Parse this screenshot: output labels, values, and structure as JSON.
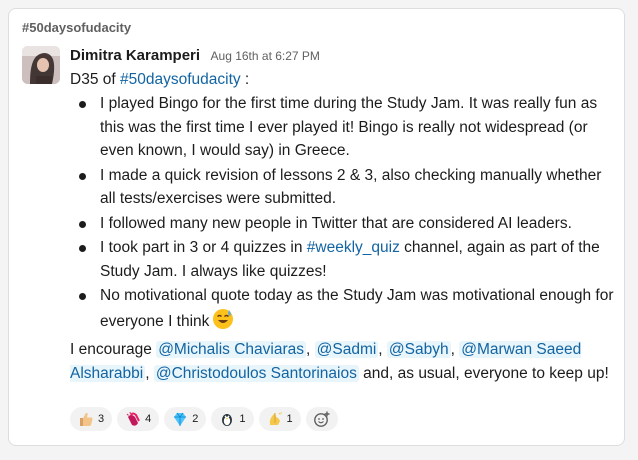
{
  "channel": "#50daysofudacity",
  "message": {
    "author": "Dimitra Karamperi",
    "timestamp": "Aug 16th at 6:27 PM",
    "intro_prefix": "D35 of ",
    "intro_hashtag": "#50daysofudacity",
    "intro_suffix": " :",
    "bullets": [
      "I played Bingo for the first time during the Study Jam. It was really fun as this was the first time I ever played it! Bingo is really not widespread (or even known, I would say) in Greece.",
      "I made a quick revision of lessons 2 & 3, also checking manually whether all tests/exercises were submitted.",
      "I followed many new people in Twitter that are considered AI leaders."
    ],
    "bullet4_before": "I took part in 3 or 4 quizzes in ",
    "bullet4_channel": "#weekly_quiz",
    "bullet4_after": " channel, again as part of the Study Jam. I always like quizzes!",
    "bullet5": "No motivational quote today as the Study Jam was motivational enough for everyone I think",
    "closing_before": "I encourage ",
    "mentions": [
      "@Michalis Chaviaras",
      "@Sadmi",
      "@Sabyh",
      "@Marwan Saeed Alsharabbi",
      "@Christodoulos Santorinaios"
    ],
    "separator": ", ",
    "closing_after": " and, as usual, everyone to keep up!"
  },
  "reactions": [
    {
      "icon": "thumbs-up-icon",
      "count": "3"
    },
    {
      "icon": "clapping-hands-icon",
      "count": "4"
    },
    {
      "icon": "gem-icon",
      "count": "2"
    },
    {
      "icon": "penguin-icon",
      "count": "1"
    },
    {
      "icon": "pray-hands-icon",
      "count": "1"
    }
  ],
  "colors": {
    "link": "#1264a3",
    "mention_bg": "#e8f5fa",
    "text": "#1d1c1d",
    "muted": "#616061"
  }
}
